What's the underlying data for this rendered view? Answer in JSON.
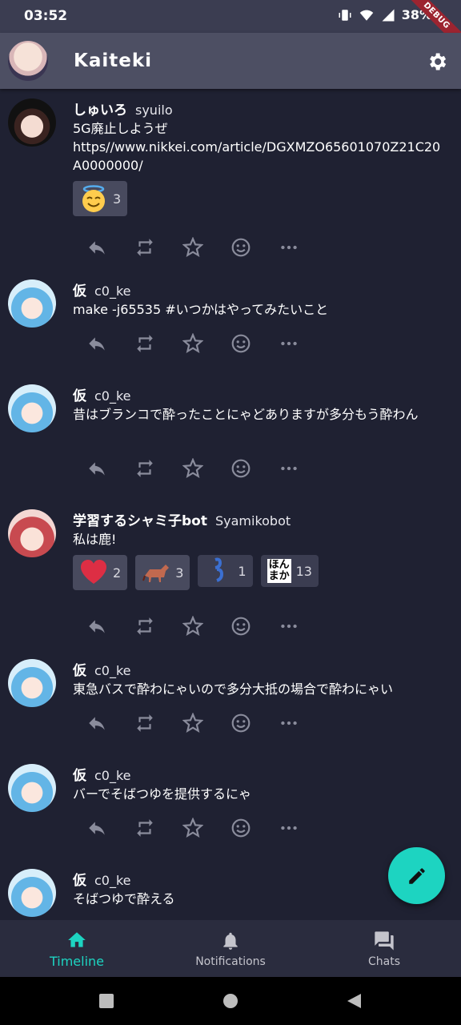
{
  "status_bar": {
    "time": "03:52",
    "battery": "38%",
    "debug_banner": "DEBUG"
  },
  "app_bar": {
    "title": "Kaiteki",
    "settings_icon": "gear-icon"
  },
  "accent_color": "#1dd4c1",
  "posts": [
    {
      "display_name": "しゅいろ",
      "username": "syuilo",
      "text": "5G廃止しようぜ\nhttps//www.nikkei.com/article/DGXMZO65601070Z21C20A0000000/",
      "reactions": [
        {
          "emoji": "smiling-face-with-halo",
          "count": "3"
        }
      ]
    },
    {
      "display_name": "仮",
      "username": "c0_ke",
      "text": "make -j65535 #いつかはやってみたいこと",
      "reactions": []
    },
    {
      "display_name": "仮",
      "username": "c0_ke",
      "text": "昔はブランコで酔ったことにゃどありますが多分もう酔わん",
      "reactions": []
    },
    {
      "display_name": "学習するシャミ子bot",
      "username": "Syamikobot",
      "text": "私は鹿!",
      "reactions": [
        {
          "emoji": "red-heart",
          "count": "2"
        },
        {
          "emoji": "horse",
          "count": "3"
        },
        {
          "emoji": "custom-emoji",
          "count": "1"
        },
        {
          "emoji": "honmaka-text-emoji",
          "label": "ほん\nまか",
          "count": "13"
        }
      ]
    },
    {
      "display_name": "仮",
      "username": "c0_ke",
      "text": "東急バスで酔わにゃいので多分大抵の場合で酔わにゃい",
      "reactions": []
    },
    {
      "display_name": "仮",
      "username": "c0_ke",
      "text": "バーでそばつゆを提供するにゃ",
      "reactions": []
    },
    {
      "display_name": "仮",
      "username": "c0_ke",
      "text": "そばつゆで酔える",
      "reactions": []
    }
  ],
  "action_icons": [
    "reply-icon",
    "repeat-icon",
    "star-icon",
    "emoji-icon",
    "more-icon"
  ],
  "fab": {
    "icon": "pencil-icon"
  },
  "bottom_nav": [
    {
      "label": "Timeline",
      "icon": "home-icon",
      "active": true
    },
    {
      "label": "Notifications",
      "icon": "bell-icon",
      "active": false
    },
    {
      "label": "Chats",
      "icon": "chat-icon",
      "active": false
    }
  ]
}
